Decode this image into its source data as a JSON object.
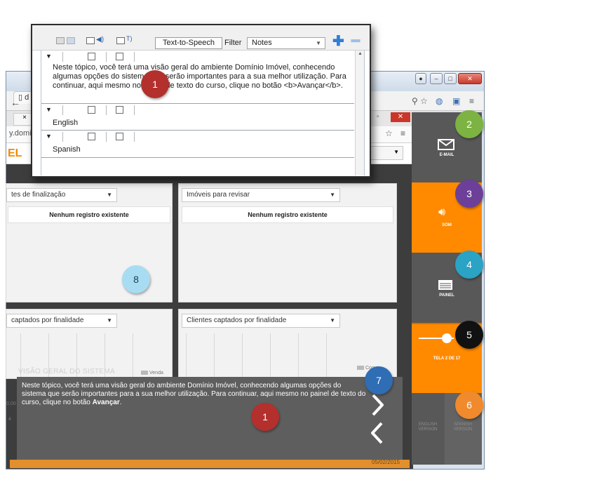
{
  "notes_window": {
    "toolbar": {
      "tts_button": "Text-to-Speech",
      "filter_label": "Filter",
      "filter_value": "Notes"
    },
    "rows": [
      {
        "text": "Neste tópico, você terá uma visão geral do ambiente Domínio Imóvel, conhecendo algumas opções do sistema que serão importantes para a sua melhor utilização. Para continuar, aqui mesmo no painel de texto do curso, clique no botão <b>Avançar</b>."
      },
      {
        "text": "English"
      },
      {
        "text": "Spanish"
      }
    ]
  },
  "browser": {
    "tab_label": "d",
    "url_fragment": "y.domi",
    "logo_text": "EL",
    "inner_tab_close": "×"
  },
  "panels": {
    "top_left": {
      "dropdown": "tes de finalização",
      "empty": "Nenhum registro existente"
    },
    "top_right": {
      "dropdown": "Imóveis para revisar",
      "empty": "Nenhum registro existente"
    },
    "bottom_left": {
      "dropdown": "captados por finalidade",
      "legend": "Venda"
    },
    "bottom_right": {
      "dropdown": "Clientes captados por finalidade",
      "legend": "Comp"
    }
  },
  "watermark": "VISÃO GERAL DO SISTEMA",
  "axis_ticks": [
    "0,00",
    "4"
  ],
  "text_panel": {
    "before": "Neste tópico, você terá uma visão geral do ambiente Domínio Imóvel, conhecendo algumas opções do sistema que serão importantes para a sua melhor utilização. Para continuar, aqui mesmo no painel de texto do curso, clique no botão ",
    "bold": "Avançar",
    "after": "."
  },
  "date": "05/02/2015",
  "sidebar": {
    "email": "E-MAIL",
    "sound": "SOM",
    "panel": "PAINEL",
    "screen": "TELA 2 DE 17",
    "english_version": [
      "ENGLISH",
      "VERSION"
    ],
    "spanish_version": [
      "SPANISH",
      "VERSION"
    ],
    "slider_level": 0.8
  },
  "badges": [
    {
      "n": "1",
      "color": "#b3302d"
    },
    {
      "n": "2",
      "color": "#7cb342"
    },
    {
      "n": "3",
      "color": "#6c3f99"
    },
    {
      "n": "4",
      "color": "#2aa3c4"
    },
    {
      "n": "5",
      "color": "#111111"
    },
    {
      "n": "6",
      "color": "#f08a2c"
    },
    {
      "n": "7",
      "color": "#2f6db5"
    },
    {
      "n": "8",
      "color": "#a8dcf2"
    },
    {
      "n": "1",
      "color": "#b3302d"
    }
  ],
  "colors": {
    "accent_orange": "#ff8a00",
    "sidebar_gray": "#585858",
    "link_blue": "#2f7ed8"
  }
}
